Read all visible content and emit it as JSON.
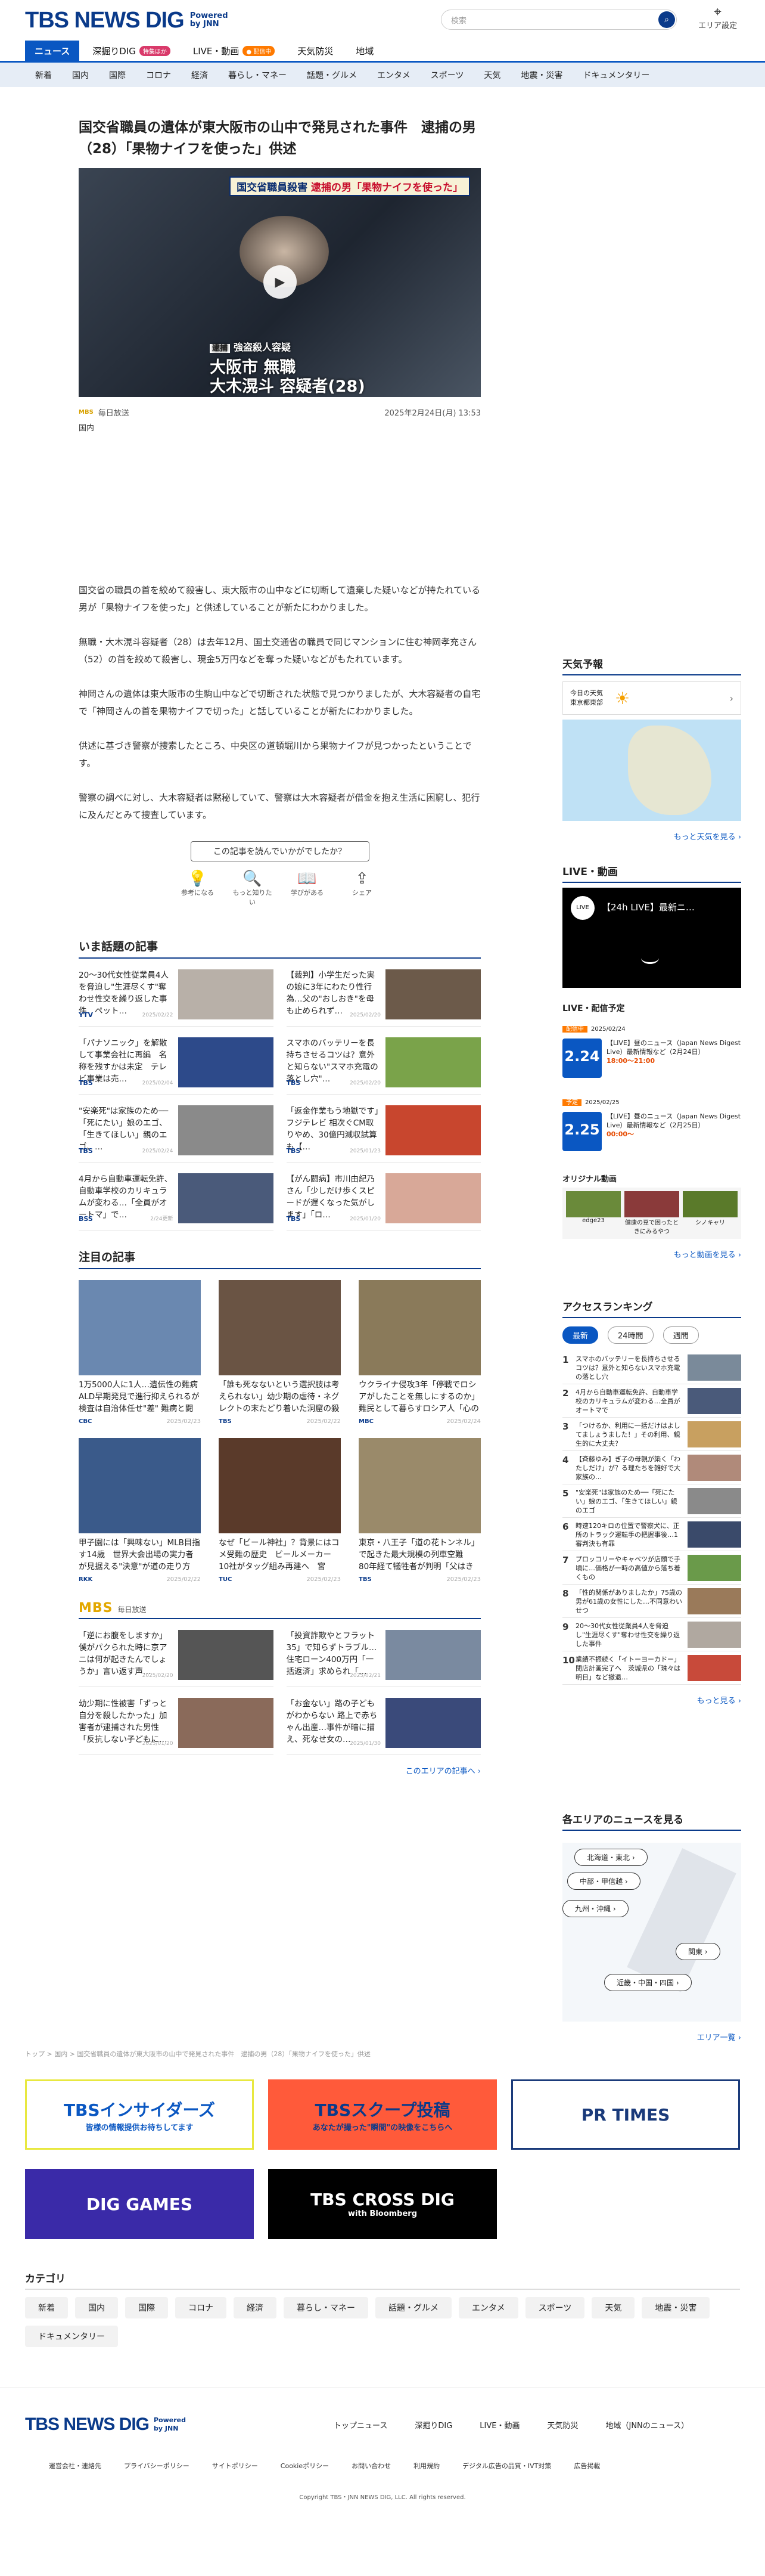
{
  "header": {
    "logo": "TBS NEWS DIG",
    "powered": "Powered by JNN",
    "search_placeholder": "検索",
    "area_label": "エリア設定"
  },
  "nav_primary": [
    {
      "label": "ニュース",
      "active": true
    },
    {
      "label": "深掘りDIG",
      "badge": "特集ほか",
      "badge_color": "#d93a6a"
    },
    {
      "label": "LIVE・動画",
      "badge": "● 配信中",
      "badge_color": "#ff7a00"
    },
    {
      "label": "天気防災"
    },
    {
      "label": "地域"
    }
  ],
  "nav_categories": [
    "新着",
    "国内",
    "国際",
    "コロナ",
    "経済",
    "暮らし・マネー",
    "話題・グルメ",
    "エンタメ",
    "スポーツ",
    "天気",
    "地震・災害",
    "ドキュメンタリー"
  ],
  "article": {
    "title": "国交省職員の遺体が東大阪市の山中で発見された事件　逮捕の男（28）「果物ナイフを使った」供述",
    "caption_top": "国交省職員殺害",
    "caption_top2": "逮捕の男「果物ナイフを使った」",
    "caption_tag": "逮捕",
    "caption_charge": "強盗殺人容疑",
    "caption_city": "大阪市 無職",
    "caption_name": "大木滉斗 容疑者(28)",
    "source_logo": "MBS",
    "source": "毎日放送",
    "date": "2025年2月24日(月) 13:53",
    "category": "国内",
    "paragraphs": [
      "国交省の職員の首を絞めて殺害し、東大阪市の山中などに切断して遺棄した疑いなどが持たれている男が「果物ナイフを使った」と供述していることが新たにわかりました。",
      "無職・大木滉斗容疑者（28）は去年12月、国土交通省の職員で同じマンションに住む神岡孝充さん（52）の首を絞めて殺害し、現金5万円などを奪った疑いなどがもたれています。",
      "神岡さんの遺体は東大阪市の生駒山中などで切断された状態で見つかりましたが、大木容疑者の自宅で「神岡さんの首を果物ナイフで切った」と話していることが新たにわかりました。",
      "供述に基づき警察が捜索したところ、中央区の道頓堀川から果物ナイフが見つかったということです。",
      "警察の調べに対し、大木容疑者は黙秘していて、警察は大木容疑者が借金を抱え生活に困窮し、犯行に及んだとみて捜査しています。"
    ],
    "feedback_question": "この記事を読んでいかがでしたか？",
    "reactions": [
      {
        "label": "参考になる",
        "icon": "lightbulb-icon",
        "glyph": "💡"
      },
      {
        "label": "もっと知りたい",
        "icon": "search-icon",
        "glyph": "🔍"
      },
      {
        "label": "学びがある",
        "icon": "book-icon",
        "glyph": "📖"
      },
      {
        "label": "シェア",
        "icon": "share-icon",
        "glyph": "⇪"
      }
    ]
  },
  "trending": {
    "heading": "いま話題の記事",
    "items": [
      {
        "title": "20～30代女性従業員4人を脅迫し\"生涯尽くす\"奪わせ性交を繰り返した事件　ペット…",
        "src": "YTV",
        "date": "2025/02/22",
        "color": "#b8b0a8"
      },
      {
        "title": "【裁判】小学生だった実の娘に3年にわたり性行為…父の\"おしおき\"を母も止められず…",
        "src": "",
        "date": "2025/02/20",
        "color": "#6c5a4a"
      },
      {
        "title": "「パナソニック」を解散して事業会社に再編　名称を残すかは未定　テレビ事業は売…",
        "src": "TBS",
        "date": "2025/02/04",
        "color": "#2d4a8a"
      },
      {
        "title": "スマホのバッテリーを長持ちさせるコツは？意外と知らない\"スマホ充電の落とし穴\"…",
        "src": "TBS",
        "date": "2025/02/20",
        "color": "#7aa34a"
      },
      {
        "title": "\"安楽死\"は家族のため──「死にたい」娘のエゴ、「生きてほしい」親のエゴ、…",
        "src": "TBS",
        "date": "2025/02/24",
        "color": "#8a8a8a"
      },
      {
        "title": "「返金作業もう地獄です」フジテレビ 相次ぐCM取りやめ、30億円減収試算も【…",
        "src": "TBS",
        "date": "2025/01/23",
        "color": "#c8462e"
      },
      {
        "title": "4月から自動車運転免許、自動車学校のカリキュラムが変わる…「全員がオートマ」で…",
        "src": "BSS",
        "date": "2/24更新",
        "color": "#4a5a7a"
      },
      {
        "title": "【がん闘病】市川由紀乃さん「少しだけ歩くスピードが遅くなった気がします」「ロ…",
        "src": "TBS",
        "date": "2025/01/20",
        "color": "#d8a898"
      }
    ]
  },
  "featured": {
    "heading": "注目の記事",
    "items": [
      {
        "title": "1万5000人に1人…遺伝性の難病ALD早期発見で進行抑えられるが検査は自治体任せ\"差\" 難病と闘う2…",
        "src": "CBC",
        "date": "2025/02/23",
        "color": "#6a88b0"
      },
      {
        "title": "「誰も死なないという選択肢は考えられない」幼少期の虐待・ネグレクトの末たどり着いた洞窟の殺害…",
        "src": "TBS",
        "date": "2025/02/22",
        "color": "#6a5444"
      },
      {
        "title": "ウクライナ侵攻3年「停戦でロシアがしたことを無しにするのか」 難民として暮らすロシア人「心の限界…",
        "src": "MBC",
        "date": "2025/02/24",
        "color": "#8a7a5a"
      },
      {
        "title": "甲子園には「興味ない」MLB目指す14歳　世界大会出場の実力者が見据える\"決意\"が道の走り方",
        "src": "RKK",
        "date": "2025/02/22",
        "color": "#3a5a8a"
      },
      {
        "title": "なぜ「ビール神社」？背景にはコメ受難の歴史　ビールメーカー10社がタッグ組み再建へ　宮城・石巻市",
        "src": "TUC",
        "date": "2025/02/23",
        "color": "#5a3a2a"
      },
      {
        "title": "東京・八王子「道の花トンネル」で起きた最大規模の列車空難　80年経て犠牲者が判明「父はきっと空…",
        "src": "TBS",
        "date": "2025/02/23",
        "color": "#9a8a6a"
      }
    ]
  },
  "mbs": {
    "logo": "MBS",
    "label": "毎日放送",
    "more": "このエリアの記事へ ›",
    "items": [
      {
        "title": "「逆にお腹をしますか」僕がパクられた時に京アニは何が起きたんでしょうか」言い返す声…",
        "date": "2025/02/20",
        "color": "#555"
      },
      {
        "title": "「投資詐欺やとフラット35」で知らずトラブル…住宅ローン400万円「一括返済」求められ「…",
        "date": "2025/02/21",
        "color": "#7a8aa0"
      },
      {
        "title": "幼少期に性被害「ずっと自分を殺したかった」加害者が逮捕された男性「反抗しない子どもに…",
        "date": "2025/01/20",
        "color": "#8a6a5a"
      },
      {
        "title": "「お金ない」路の子どもがわからない 路上で赤ちゃん出産…事件が暗に描え、死なせ女の…",
        "date": "2025/01/30",
        "color": "#3a4a7a"
      }
    ]
  },
  "breadcrumb": "トップ > 国内 > 国交省職員の遺体が東大阪市の山中で発見された事件　逮捕の男（28）「果物ナイフを使った」供述",
  "banners": [
    {
      "label": "TBSインサイダーズ",
      "sub": "皆様の情報提供お待ちしてます",
      "bg": "#fff",
      "fg": "#0a57c2",
      "border": "#e8e840"
    },
    {
      "label": "TBSスクープ投稿",
      "sub": "あなたが撮った\"瞬間\"の映像をこちらへ",
      "bg": "#ff5a3a",
      "fg": "#0a3a8a",
      "border": "#ff5a3a"
    },
    {
      "label": "PR TIMES",
      "sub": "",
      "bg": "#fff",
      "fg": "#1a3a7a",
      "border": "#1a3a7a"
    },
    {
      "label": "DIG GAMES",
      "sub": "",
      "bg": "#3a2aa8",
      "fg": "#fff",
      "border": "#3a2aa8"
    },
    {
      "label": "TBS CROSS DIG",
      "sub": "with Bloomberg",
      "bg": "#000",
      "fg": "#fff",
      "border": "#000"
    }
  ],
  "categories": {
    "heading": "カテゴリ",
    "items": [
      "新着",
      "国内",
      "国際",
      "コロナ",
      "経済",
      "暮らし・マネー",
      "話題・グルメ",
      "エンタメ",
      "スポーツ",
      "天気",
      "地震・災害",
      "ドキュメンタリー"
    ]
  },
  "footer": {
    "logo": "TBS NEWS DIG",
    "powered": "Powered by JNN",
    "links": [
      "トップニュース",
      "深掘りDIG",
      "LIVE・動画",
      "天気防災",
      "地域（JNNのニュース）"
    ],
    "sublinks": [
      "運営会社・連絡先",
      "プライバシーポリシー",
      "サイトポリシー",
      "Cookieポリシー",
      "お問い合わせ",
      "利用規約",
      "デジタル広告の品質・IVT対策",
      "広告掲載"
    ],
    "copyright": "Copyright TBS・JNN NEWS DIG, LLC. All rights reserved."
  },
  "sidebar": {
    "weather": {
      "heading": "天気予報",
      "today": "今日の天気",
      "region": "東京都東部",
      "more": "もっと天気を見る ›"
    },
    "live": {
      "heading": "LIVE・動画",
      "tag": "LIVE",
      "title": "【24h LIVE】最新ニ…"
    },
    "schedule": {
      "heading": "LIVE・配信予定",
      "items": [
        {
          "status": "配信中",
          "date": "2025/02/24",
          "day": "2.24",
          "title": "【LIVE】昼のニュース（Japan News Digest Live）最新情報など（2月24日）",
          "time": "18:00～21:00"
        },
        {
          "status": "予定",
          "date": "2025/02/25",
          "day": "2.25",
          "title": "【LIVE】昼のニュース（Japan News Digest Live）最新情報など（2月25日）",
          "time": "00:00～"
        }
      ]
    },
    "original": {
      "heading": "オリジナル動画",
      "items": [
        "edge23",
        "健康の豆で困ったときにみるやつ",
        "シノキャリ"
      ],
      "more": "もっと動画を見る ›"
    },
    "ranking": {
      "heading": "アクセスランキング",
      "tabs": [
        "最新",
        "24時間",
        "週間"
      ],
      "items": [
        "スマホのバッテリーを長持ちさせるコツは？意外と知らないスマホ充電の落とし穴",
        "4月から自動車運転免許、自動車学校のカリキュラムが変わる…全員がオートマで",
        "「つけるか、利用に一括だけはよしてましょうました！」その利用、親生的に大丈夫？",
        "【斉藤ゆみ】ぎ子の母親が築く「わたしだけ」が？る理たちを雑好で大家族の…",
        "\"安楽死\"は家族のため──「死にたい」娘のエゴ、「生きてほしい」親のエゴ",
        "時速120キロの位置で警察犬に、正所のトラック運転手の把握事後…1審判決も有罪",
        "プロッコリーやキャベツが店頭で手頃に…価格が一時の高値から落ち着くもの",
        "「性的関係がありましたか」75歳の男が61歳の女性にした…不同意わいせつ",
        "20～30代女性従業員4人を脅迫し\"生涯尽くす\"奪わせ性交を繰り返した事件",
        "業績不振続く「イトーヨーカドー」閉店計画完了へ　茨城県の「珠々は明日」など撤退…"
      ],
      "more": "もっと見る ›"
    },
    "areas": {
      "heading": "各エリアのニュースを見る",
      "buttons": [
        "北海道・東北 ›",
        "中部・甲信越 ›",
        "九州・沖縄 ›",
        "関東 ›",
        "近畿・中国・四国 ›"
      ],
      "more": "エリア一覧 ›"
    }
  }
}
